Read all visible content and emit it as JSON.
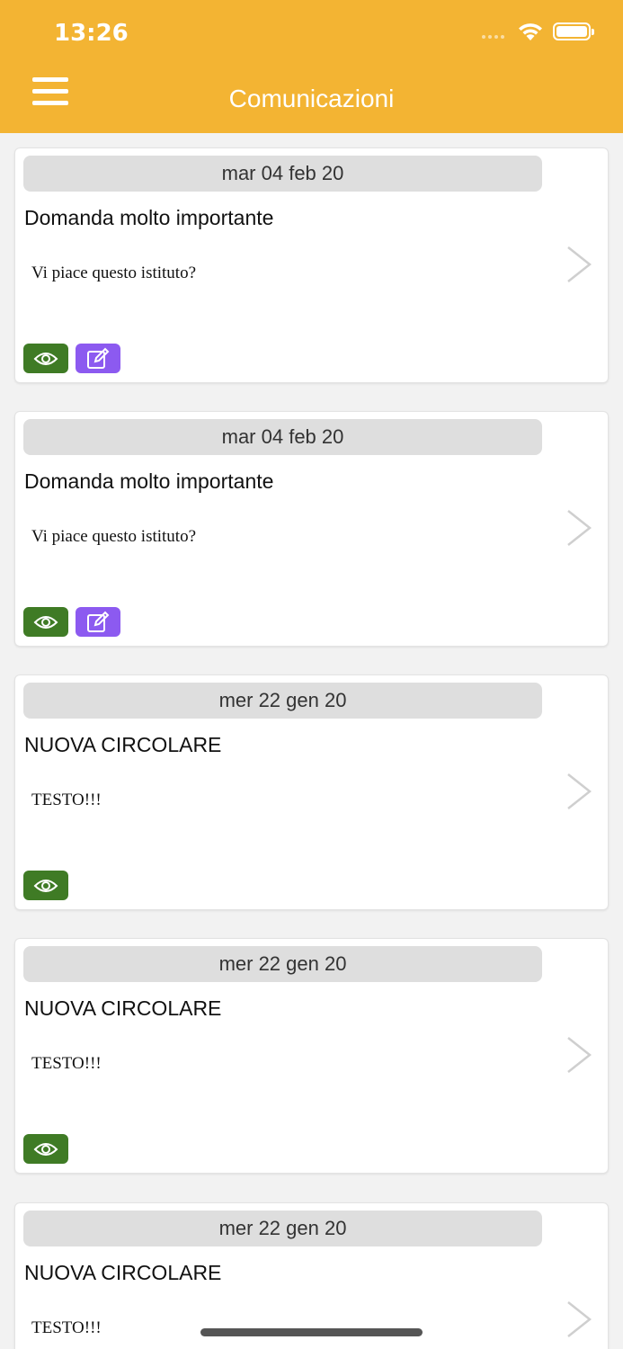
{
  "status_bar": {
    "time": "13:26"
  },
  "header": {
    "title": "Comunicazioni"
  },
  "colors": {
    "header": "#f3b433",
    "eye_badge": "#3f7b25",
    "edit_badge": "#8c5af0",
    "date_pill": "#dedede"
  },
  "cards": [
    {
      "date": "mar 04 feb 20",
      "title": "Domanda molto importante",
      "body": "Vi piace questo istituto?",
      "badges": [
        "eye-icon",
        "edit-icon"
      ]
    },
    {
      "date": "mar 04 feb 20",
      "title": "Domanda molto importante",
      "body": "Vi piace questo istituto?",
      "badges": [
        "eye-icon",
        "edit-icon"
      ]
    },
    {
      "date": "mer 22 gen 20",
      "title": "NUOVA CIRCOLARE",
      "body": "TESTO!!!",
      "badges": [
        "eye-icon"
      ]
    },
    {
      "date": "mer 22 gen 20",
      "title": "NUOVA CIRCOLARE",
      "body": "TESTO!!!",
      "badges": [
        "eye-icon"
      ]
    },
    {
      "date": "mer 22 gen 20",
      "title": "NUOVA CIRCOLARE",
      "body": "TESTO!!!",
      "badges": []
    }
  ]
}
